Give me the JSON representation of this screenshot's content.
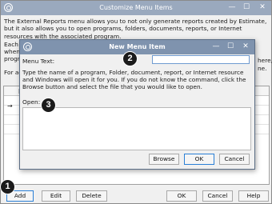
{
  "outer": {
    "title": "Customize Menu Items",
    "description": "The External Reports menu allows you to not only generate reports created by Estimate, but it also allows you to open programs, folders, documents, reports, or Internet resources with the associated program.",
    "partial_left_1": "Each m",
    "partial_left_2": "when y",
    "partial_left_3": "progra",
    "partial_left_4": "For ad",
    "partial_right_1": "here,",
    "partial_right_2": "ne.",
    "list_header_partial": "M",
    "row_arrow": "→",
    "buttons": {
      "add": "Add",
      "edit": "Edit",
      "delete": "Delete",
      "ok": "OK",
      "cancel": "Cancel",
      "help": "Help"
    }
  },
  "dialog": {
    "title": "New Menu Item",
    "menu_text_label": "Menu Text:",
    "menu_text_value": "",
    "instructions": "Type the name of a program, Folder, document, report, or Internet resource and Windows will open it for you.  If you do not know the command, click the Browse button and select the file that you would like to open.",
    "open_label": "Open:",
    "open_value": "",
    "buttons": {
      "browse": "Browse",
      "ok": "OK",
      "cancel": "Cancel"
    }
  },
  "window_controls": {
    "minimize": "—",
    "maximize": "☐",
    "close": "✕"
  },
  "callouts": [
    "1",
    "2",
    "3"
  ]
}
